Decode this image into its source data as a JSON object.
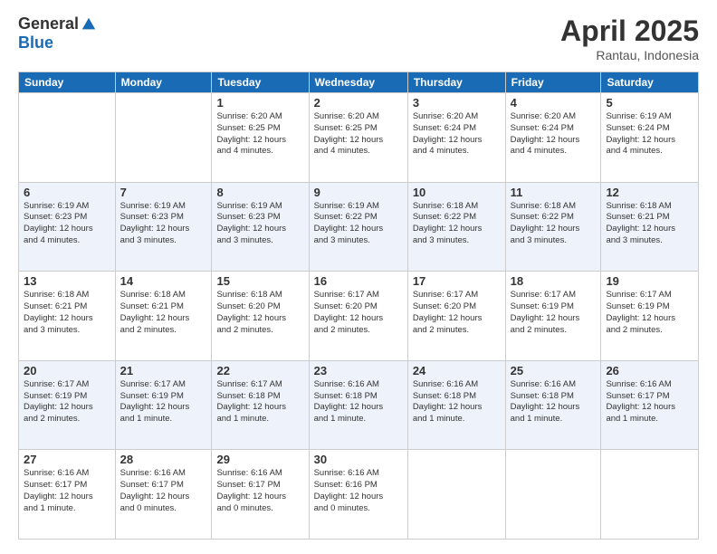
{
  "logo": {
    "general": "General",
    "blue": "Blue"
  },
  "title": "April 2025",
  "subtitle": "Rantau, Indonesia",
  "days_of_week": [
    "Sunday",
    "Monday",
    "Tuesday",
    "Wednesday",
    "Thursday",
    "Friday",
    "Saturday"
  ],
  "weeks": [
    [
      {
        "day": "",
        "info": ""
      },
      {
        "day": "",
        "info": ""
      },
      {
        "day": "1",
        "info": "Sunrise: 6:20 AM\nSunset: 6:25 PM\nDaylight: 12 hours\nand 4 minutes."
      },
      {
        "day": "2",
        "info": "Sunrise: 6:20 AM\nSunset: 6:25 PM\nDaylight: 12 hours\nand 4 minutes."
      },
      {
        "day": "3",
        "info": "Sunrise: 6:20 AM\nSunset: 6:24 PM\nDaylight: 12 hours\nand 4 minutes."
      },
      {
        "day": "4",
        "info": "Sunrise: 6:20 AM\nSunset: 6:24 PM\nDaylight: 12 hours\nand 4 minutes."
      },
      {
        "day": "5",
        "info": "Sunrise: 6:19 AM\nSunset: 6:24 PM\nDaylight: 12 hours\nand 4 minutes."
      }
    ],
    [
      {
        "day": "6",
        "info": "Sunrise: 6:19 AM\nSunset: 6:23 PM\nDaylight: 12 hours\nand 4 minutes."
      },
      {
        "day": "7",
        "info": "Sunrise: 6:19 AM\nSunset: 6:23 PM\nDaylight: 12 hours\nand 3 minutes."
      },
      {
        "day": "8",
        "info": "Sunrise: 6:19 AM\nSunset: 6:23 PM\nDaylight: 12 hours\nand 3 minutes."
      },
      {
        "day": "9",
        "info": "Sunrise: 6:19 AM\nSunset: 6:22 PM\nDaylight: 12 hours\nand 3 minutes."
      },
      {
        "day": "10",
        "info": "Sunrise: 6:18 AM\nSunset: 6:22 PM\nDaylight: 12 hours\nand 3 minutes."
      },
      {
        "day": "11",
        "info": "Sunrise: 6:18 AM\nSunset: 6:22 PM\nDaylight: 12 hours\nand 3 minutes."
      },
      {
        "day": "12",
        "info": "Sunrise: 6:18 AM\nSunset: 6:21 PM\nDaylight: 12 hours\nand 3 minutes."
      }
    ],
    [
      {
        "day": "13",
        "info": "Sunrise: 6:18 AM\nSunset: 6:21 PM\nDaylight: 12 hours\nand 3 minutes."
      },
      {
        "day": "14",
        "info": "Sunrise: 6:18 AM\nSunset: 6:21 PM\nDaylight: 12 hours\nand 2 minutes."
      },
      {
        "day": "15",
        "info": "Sunrise: 6:18 AM\nSunset: 6:20 PM\nDaylight: 12 hours\nand 2 minutes."
      },
      {
        "day": "16",
        "info": "Sunrise: 6:17 AM\nSunset: 6:20 PM\nDaylight: 12 hours\nand 2 minutes."
      },
      {
        "day": "17",
        "info": "Sunrise: 6:17 AM\nSunset: 6:20 PM\nDaylight: 12 hours\nand 2 minutes."
      },
      {
        "day": "18",
        "info": "Sunrise: 6:17 AM\nSunset: 6:19 PM\nDaylight: 12 hours\nand 2 minutes."
      },
      {
        "day": "19",
        "info": "Sunrise: 6:17 AM\nSunset: 6:19 PM\nDaylight: 12 hours\nand 2 minutes."
      }
    ],
    [
      {
        "day": "20",
        "info": "Sunrise: 6:17 AM\nSunset: 6:19 PM\nDaylight: 12 hours\nand 2 minutes."
      },
      {
        "day": "21",
        "info": "Sunrise: 6:17 AM\nSunset: 6:19 PM\nDaylight: 12 hours\nand 1 minute."
      },
      {
        "day": "22",
        "info": "Sunrise: 6:17 AM\nSunset: 6:18 PM\nDaylight: 12 hours\nand 1 minute."
      },
      {
        "day": "23",
        "info": "Sunrise: 6:16 AM\nSunset: 6:18 PM\nDaylight: 12 hours\nand 1 minute."
      },
      {
        "day": "24",
        "info": "Sunrise: 6:16 AM\nSunset: 6:18 PM\nDaylight: 12 hours\nand 1 minute."
      },
      {
        "day": "25",
        "info": "Sunrise: 6:16 AM\nSunset: 6:18 PM\nDaylight: 12 hours\nand 1 minute."
      },
      {
        "day": "26",
        "info": "Sunrise: 6:16 AM\nSunset: 6:17 PM\nDaylight: 12 hours\nand 1 minute."
      }
    ],
    [
      {
        "day": "27",
        "info": "Sunrise: 6:16 AM\nSunset: 6:17 PM\nDaylight: 12 hours\nand 1 minute."
      },
      {
        "day": "28",
        "info": "Sunrise: 6:16 AM\nSunset: 6:17 PM\nDaylight: 12 hours\nand 0 minutes."
      },
      {
        "day": "29",
        "info": "Sunrise: 6:16 AM\nSunset: 6:17 PM\nDaylight: 12 hours\nand 0 minutes."
      },
      {
        "day": "30",
        "info": "Sunrise: 6:16 AM\nSunset: 6:16 PM\nDaylight: 12 hours\nand 0 minutes."
      },
      {
        "day": "",
        "info": ""
      },
      {
        "day": "",
        "info": ""
      },
      {
        "day": "",
        "info": ""
      }
    ]
  ]
}
